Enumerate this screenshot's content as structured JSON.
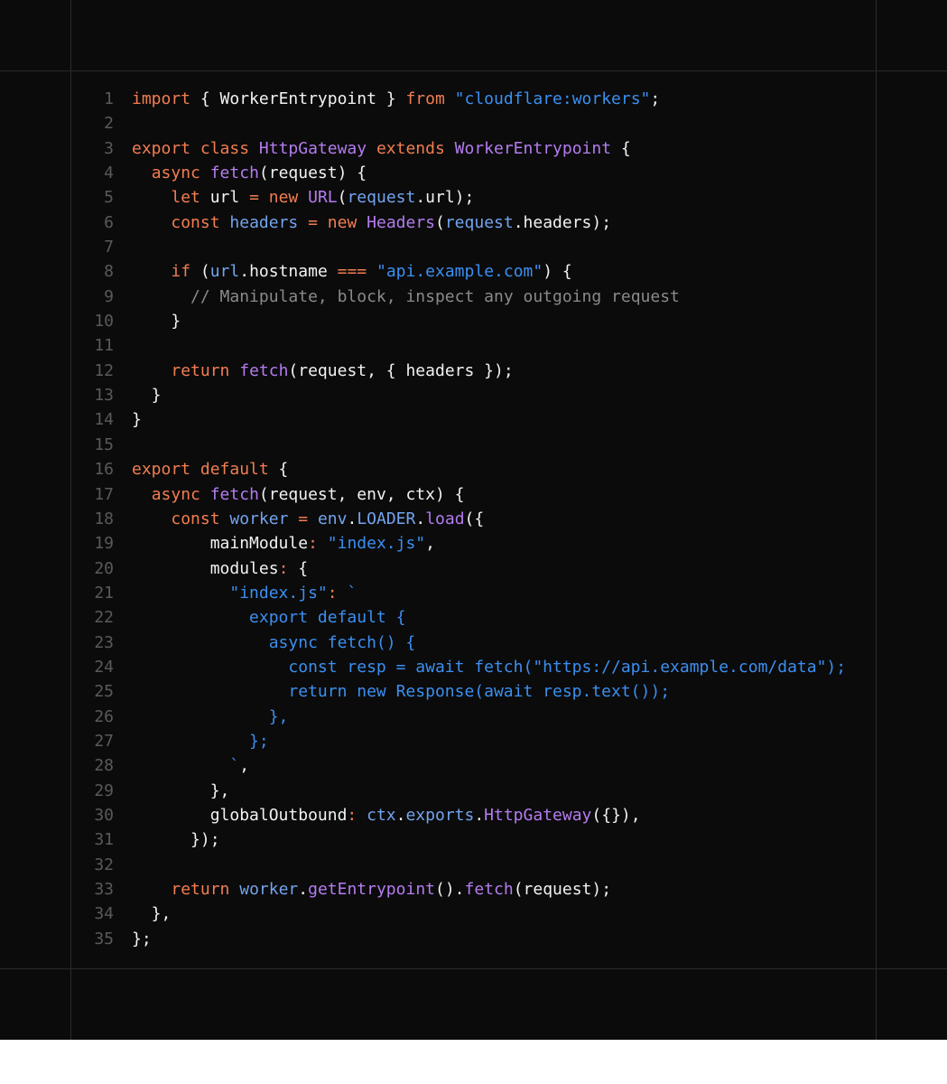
{
  "editor": {
    "lines": [
      {
        "n": "1",
        "tokens": [
          [
            "k",
            "import"
          ],
          [
            "p",
            " { WorkerEntrypoint } "
          ],
          [
            "k",
            "from"
          ],
          [
            "p",
            " "
          ],
          [
            "s",
            "\"cloudflare:workers\""
          ],
          [
            "p",
            ";"
          ]
        ]
      },
      {
        "n": "2",
        "tokens": []
      },
      {
        "n": "3",
        "tokens": [
          [
            "k",
            "export class"
          ],
          [
            "p",
            " "
          ],
          [
            "f",
            "HttpGateway"
          ],
          [
            "p",
            " "
          ],
          [
            "k",
            "extends"
          ],
          [
            "p",
            " "
          ],
          [
            "f",
            "WorkerEntrypoint"
          ],
          [
            "p",
            " {"
          ]
        ]
      },
      {
        "n": "4",
        "tokens": [
          [
            "p",
            "  "
          ],
          [
            "k",
            "async"
          ],
          [
            "p",
            " "
          ],
          [
            "f",
            "fetch"
          ],
          [
            "p",
            "(request) {"
          ]
        ]
      },
      {
        "n": "5",
        "tokens": [
          [
            "p",
            "    "
          ],
          [
            "k",
            "let"
          ],
          [
            "p",
            " url "
          ],
          [
            "k",
            "="
          ],
          [
            "p",
            " "
          ],
          [
            "k",
            "new"
          ],
          [
            "p",
            " "
          ],
          [
            "f",
            "URL"
          ],
          [
            "p",
            "("
          ],
          [
            "v",
            "request"
          ],
          [
            "p",
            ".url);"
          ]
        ]
      },
      {
        "n": "6",
        "tokens": [
          [
            "p",
            "    "
          ],
          [
            "k",
            "const"
          ],
          [
            "p",
            " "
          ],
          [
            "v",
            "headers"
          ],
          [
            "p",
            " "
          ],
          [
            "k",
            "="
          ],
          [
            "p",
            " "
          ],
          [
            "k",
            "new"
          ],
          [
            "p",
            " "
          ],
          [
            "f",
            "Headers"
          ],
          [
            "p",
            "("
          ],
          [
            "v",
            "request"
          ],
          [
            "p",
            ".headers);"
          ]
        ]
      },
      {
        "n": "7",
        "tokens": []
      },
      {
        "n": "8",
        "tokens": [
          [
            "p",
            "    "
          ],
          [
            "k",
            "if"
          ],
          [
            "p",
            " ("
          ],
          [
            "v",
            "url"
          ],
          [
            "p",
            ".hostname "
          ],
          [
            "k",
            "==="
          ],
          [
            "p",
            " "
          ],
          [
            "s",
            "\"api.example.com\""
          ],
          [
            "p",
            ") {"
          ]
        ]
      },
      {
        "n": "9",
        "tokens": [
          [
            "p",
            "      "
          ],
          [
            "c",
            "// Manipulate, block, inspect any outgoing request"
          ]
        ]
      },
      {
        "n": "10",
        "tokens": [
          [
            "p",
            "    }"
          ]
        ]
      },
      {
        "n": "11",
        "tokens": []
      },
      {
        "n": "12",
        "tokens": [
          [
            "p",
            "    "
          ],
          [
            "k",
            "return"
          ],
          [
            "p",
            " "
          ],
          [
            "f",
            "fetch"
          ],
          [
            "p",
            "(request, { headers });"
          ]
        ]
      },
      {
        "n": "13",
        "tokens": [
          [
            "p",
            "  }"
          ]
        ]
      },
      {
        "n": "14",
        "tokens": [
          [
            "p",
            "}"
          ]
        ]
      },
      {
        "n": "15",
        "tokens": []
      },
      {
        "n": "16",
        "tokens": [
          [
            "k",
            "export default"
          ],
          [
            "p",
            " {"
          ]
        ]
      },
      {
        "n": "17",
        "tokens": [
          [
            "p",
            "  "
          ],
          [
            "k",
            "async"
          ],
          [
            "p",
            " "
          ],
          [
            "f",
            "fetch"
          ],
          [
            "p",
            "(request, env, ctx) {"
          ]
        ]
      },
      {
        "n": "18",
        "tokens": [
          [
            "p",
            "    "
          ],
          [
            "k",
            "const"
          ],
          [
            "p",
            " "
          ],
          [
            "v",
            "worker"
          ],
          [
            "p",
            " "
          ],
          [
            "k",
            "="
          ],
          [
            "p",
            " "
          ],
          [
            "v",
            "env"
          ],
          [
            "p",
            "."
          ],
          [
            "v",
            "LOADER"
          ],
          [
            "p",
            "."
          ],
          [
            "f",
            "load"
          ],
          [
            "p",
            "({"
          ]
        ]
      },
      {
        "n": "19",
        "tokens": [
          [
            "p",
            "        mainModule"
          ],
          [
            "k",
            ":"
          ],
          [
            "p",
            " "
          ],
          [
            "s",
            "\"index.js\""
          ],
          [
            "p",
            ","
          ]
        ]
      },
      {
        "n": "20",
        "tokens": [
          [
            "p",
            "        modules"
          ],
          [
            "k",
            ":"
          ],
          [
            "p",
            " {"
          ]
        ]
      },
      {
        "n": "21",
        "tokens": [
          [
            "p",
            "          "
          ],
          [
            "s",
            "\"index.js\""
          ],
          [
            "k",
            ":"
          ],
          [
            "p",
            " "
          ],
          [
            "s",
            "`"
          ]
        ]
      },
      {
        "n": "22",
        "tokens": [
          [
            "s",
            "            export default {"
          ]
        ]
      },
      {
        "n": "23",
        "tokens": [
          [
            "s",
            "              async fetch() {"
          ]
        ]
      },
      {
        "n": "24",
        "tokens": [
          [
            "s",
            "                const resp = await fetch(\"https://api.example.com/data\");"
          ]
        ]
      },
      {
        "n": "25",
        "tokens": [
          [
            "s",
            "                return new Response(await resp.text());"
          ]
        ]
      },
      {
        "n": "26",
        "tokens": [
          [
            "s",
            "              },"
          ]
        ]
      },
      {
        "n": "27",
        "tokens": [
          [
            "s",
            "            };"
          ]
        ]
      },
      {
        "n": "28",
        "tokens": [
          [
            "s",
            "          `"
          ],
          [
            "p",
            ","
          ]
        ]
      },
      {
        "n": "29",
        "tokens": [
          [
            "p",
            "        },"
          ]
        ]
      },
      {
        "n": "30",
        "tokens": [
          [
            "p",
            "        globalOutbound"
          ],
          [
            "k",
            ":"
          ],
          [
            "p",
            " "
          ],
          [
            "v",
            "ctx"
          ],
          [
            "p",
            "."
          ],
          [
            "v",
            "exports"
          ],
          [
            "p",
            "."
          ],
          [
            "f",
            "HttpGateway"
          ],
          [
            "p",
            "({}),"
          ]
        ]
      },
      {
        "n": "31",
        "tokens": [
          [
            "p",
            "      });"
          ]
        ]
      },
      {
        "n": "32",
        "tokens": []
      },
      {
        "n": "33",
        "tokens": [
          [
            "p",
            "    "
          ],
          [
            "k",
            "return"
          ],
          [
            "p",
            " "
          ],
          [
            "v",
            "worker"
          ],
          [
            "p",
            "."
          ],
          [
            "f",
            "getEntrypoint"
          ],
          [
            "p",
            "()."
          ],
          [
            "f",
            "fetch"
          ],
          [
            "p",
            "(request);"
          ]
        ]
      },
      {
        "n": "34",
        "tokens": [
          [
            "p",
            "  },"
          ]
        ]
      },
      {
        "n": "35",
        "tokens": [
          [
            "p",
            "};"
          ]
        ]
      }
    ]
  }
}
